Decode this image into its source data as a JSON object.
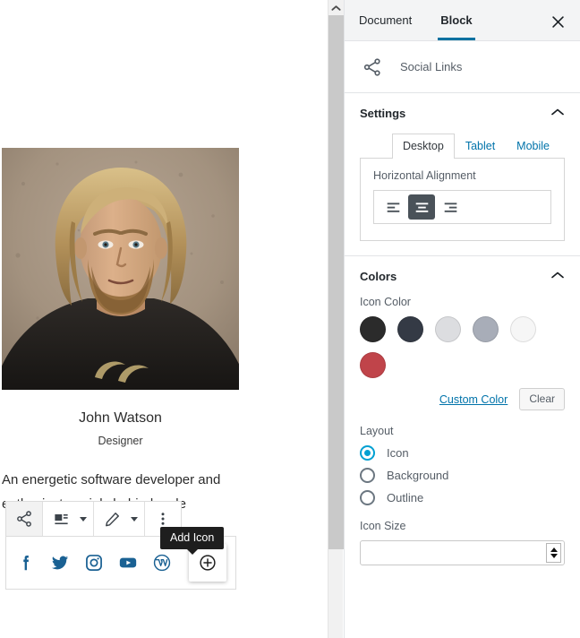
{
  "editor": {
    "person_name": "John Watson",
    "person_role": "Designer",
    "person_bio": "An energetic software developer and enthusiast..mainly behind code",
    "photo_alt": "portrait-photo",
    "toolbar": {
      "block_type_icon": "share-icon",
      "align_icon": "align-options-icon",
      "style_icon": "pencil-icon",
      "more_icon": "more-options-icon"
    },
    "social_links": [
      {
        "name": "facebook",
        "glyph": "f"
      },
      {
        "name": "twitter",
        "glyph": "twitter"
      },
      {
        "name": "instagram",
        "glyph": "instagram"
      },
      {
        "name": "youtube",
        "glyph": "youtube"
      },
      {
        "name": "wordpress",
        "glyph": "wordpress"
      }
    ],
    "add_icon_tooltip": "Add Icon",
    "social_icon_color": "#1a6193"
  },
  "scrollbar": {
    "up_arrow_icon": "chevron-up-icon",
    "thumb_color": "#c9c9c9"
  },
  "sidebar": {
    "tabs": [
      {
        "label": "Document",
        "active": false
      },
      {
        "label": "Block",
        "active": true
      }
    ],
    "close_label": "Close settings",
    "block_card": {
      "icon": "social-links-icon",
      "label": "Social Links"
    },
    "settings_panel": {
      "title": "Settings",
      "toggle_icon": "chevron-up-icon",
      "device_tabs": [
        {
          "label": "Desktop",
          "active": true
        },
        {
          "label": "Tablet",
          "active": false
        },
        {
          "label": "Mobile",
          "active": false
        }
      ],
      "alignment_label": "Horizontal Alignment",
      "alignment_options": [
        {
          "name": "align-left",
          "selected": false
        },
        {
          "name": "align-center",
          "selected": true
        },
        {
          "name": "align-right",
          "selected": false
        }
      ]
    },
    "colors_panel": {
      "title": "Colors",
      "toggle_icon": "chevron-up-icon",
      "icon_color_label": "Icon Color",
      "swatches_row1": [
        "#2b2b2b",
        "#343a45",
        "#dcdde0",
        "#a8adb8",
        "#f6f6f6"
      ],
      "swatches_row2": [
        "#c0444a"
      ],
      "custom_color_label": "Custom Color",
      "clear_label": "Clear"
    },
    "layout_panel": {
      "label": "Layout",
      "options": [
        {
          "label": "Icon",
          "selected": true
        },
        {
          "label": "Background",
          "selected": false
        },
        {
          "label": "Outline",
          "selected": false
        }
      ]
    },
    "icon_size": {
      "label": "Icon Size",
      "value": "",
      "placeholder": ""
    }
  }
}
